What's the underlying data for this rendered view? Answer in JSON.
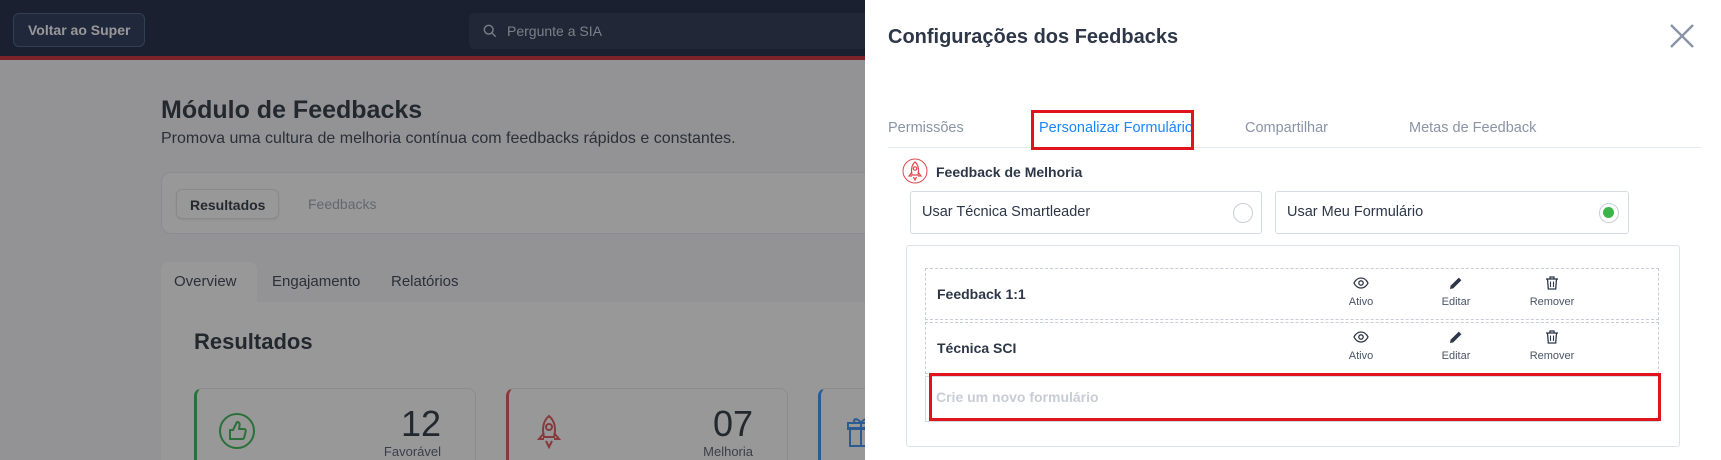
{
  "app": {
    "back_button": "Voltar ao Super",
    "search_placeholder": "Pergunte a SIA",
    "page_title": "Módulo de Feedbacks",
    "page_subtitle": "Promova uma cultura de melhoria contínua com feedbacks rápidos e constantes.",
    "tabs": [
      "Resultados",
      "Feedbacks"
    ],
    "subtabs": [
      "Overview",
      "Engajamento",
      "Relatórios"
    ],
    "results_title": "Resultados",
    "stats": [
      {
        "value": "12",
        "label": "Favorável",
        "icon": "thumbs-up-icon",
        "color": "#2fb34a"
      },
      {
        "value": "07",
        "label": "Melhoria",
        "icon": "rocket-icon",
        "color": "#e0494f"
      },
      {
        "value": "",
        "label": "",
        "icon": "gift-icon",
        "color": "#2f8af5"
      }
    ],
    "colors": {
      "topbar": "#0e1a36",
      "accent_bar": "#c8202b"
    }
  },
  "drawer": {
    "title": "Configurações dos Feedbacks",
    "tabs": [
      "Permissões",
      "Personalizar Formulário",
      "Compartilhar",
      "Metas de Feedback"
    ],
    "active_tab": "Personalizar Formulário",
    "section_title": "Feedback de Melhoria",
    "options": [
      {
        "label": "Usar Técnica Smartleader",
        "selected": false
      },
      {
        "label": "Usar Meu Formulário",
        "selected": true
      }
    ],
    "forms": [
      {
        "name": "Feedback 1:1"
      },
      {
        "name": "Técnica SCI"
      }
    ],
    "actions": {
      "view": "Ativo",
      "edit": "Editar",
      "remove": "Remover"
    },
    "new_form_placeholder": "Crie um novo formulário",
    "colors": {
      "active_tab": "#1a85ff",
      "highlight": "#e0141c",
      "radio_on": "#39b54a"
    }
  }
}
